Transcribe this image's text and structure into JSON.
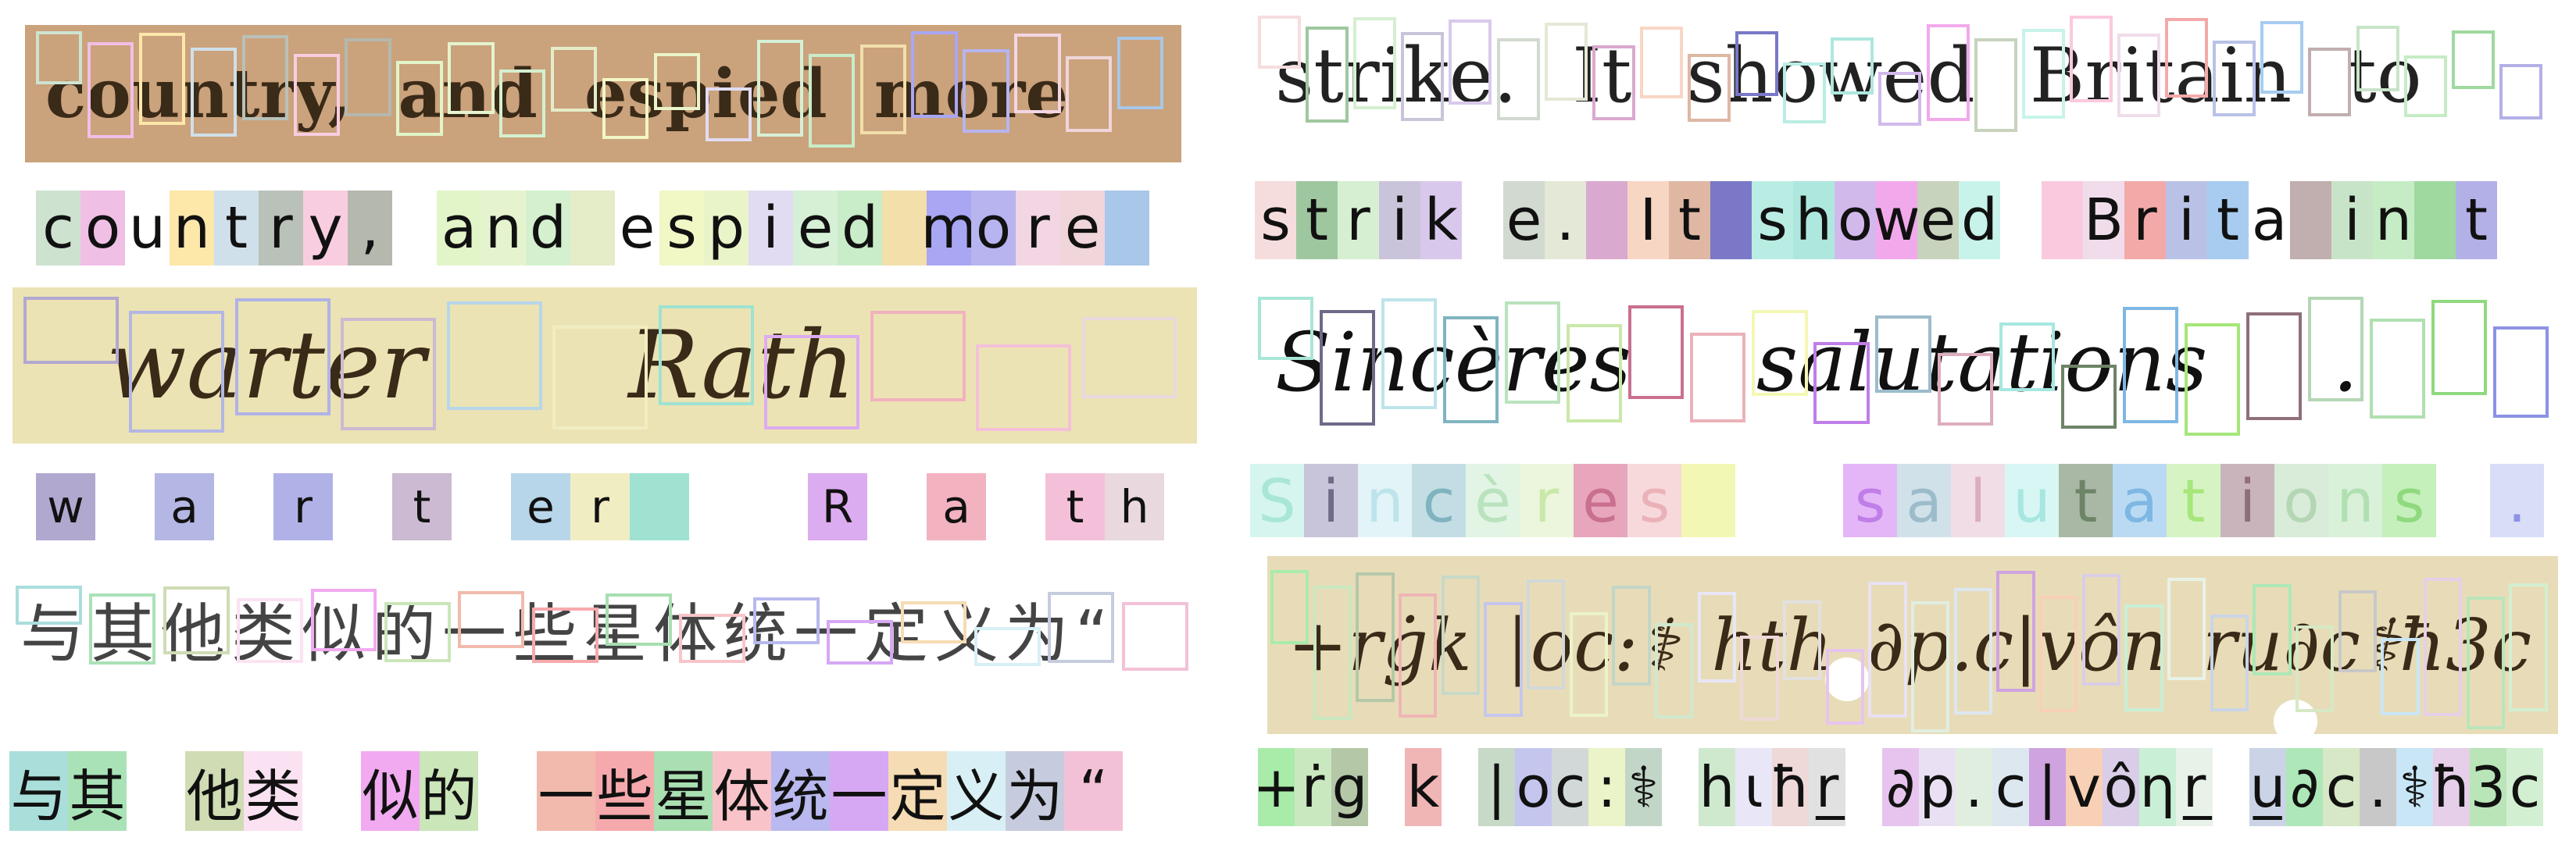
{
  "panels": [
    {
      "id": "p1",
      "image_text": [
        "country,",
        "and",
        "espied",
        "more"
      ],
      "bg": "#caa27c",
      "ink_color": "#3b2a1c",
      "ink_font": "serif",
      "cells": [
        {
          "t": "c",
          "c": "#cde3cf"
        },
        {
          "t": "o",
          "c": "#f0bfe6"
        },
        {
          "t": "u",
          "c": "#ffffff"
        },
        {
          "t": "n",
          "c": "#fde7a9"
        },
        {
          "t": "t",
          "c": "#cfe0ea"
        },
        {
          "t": "r",
          "c": "#b9c1b8"
        },
        {
          "t": "y",
          "c": "#f9cde0"
        },
        {
          "t": ",",
          "c": "#b4b8ad"
        },
        {
          "t": " ",
          "c": "#ffffff"
        },
        {
          "t": "a",
          "c": "#e2f5c8"
        },
        {
          "t": "n",
          "c": "#e5f4ce"
        },
        {
          "t": "d",
          "c": "#d4f0cf"
        },
        {
          "t": " ",
          "c": "#e4ecc8"
        },
        {
          "t": "e",
          "c": "#ffffff"
        },
        {
          "t": "s",
          "c": "#f2f7c6"
        },
        {
          "t": "p",
          "c": "#eaf4c9"
        },
        {
          "t": "i",
          "c": "#e1dcf2"
        },
        {
          "t": "e",
          "c": "#d6f0d6"
        },
        {
          "t": "d",
          "c": "#c9ecc9"
        },
        {
          "t": " ",
          "c": "#f2dfaa"
        },
        {
          "t": "m",
          "c": "#a9a6f4"
        },
        {
          "t": "o",
          "c": "#b7b4f0"
        },
        {
          "t": "r",
          "c": "#f3d6e4"
        },
        {
          "t": "e",
          "c": "#f0d5da"
        },
        {
          "t": " ",
          "c": "#a9c7e8"
        }
      ]
    },
    {
      "id": "p2",
      "image_text": [
        "strike.",
        "It",
        "showed",
        "Britain",
        "to"
      ],
      "bg": "#ffffff",
      "ink_color": "#222222",
      "ink_font": "hand",
      "cells": [
        {
          "t": "s",
          "c": "#f6dddd"
        },
        {
          "t": "t",
          "c": "#9fc79f"
        },
        {
          "t": "r",
          "c": "#d6efd2"
        },
        {
          "t": "i",
          "c": "#c9c4da"
        },
        {
          "t": "k",
          "c": "#d8c9ec"
        },
        {
          "t": " ",
          "c": "#ffffff"
        },
        {
          "t": "e",
          "c": "#d2d9d0"
        },
        {
          "t": ".",
          "c": "#e4e8d6"
        },
        {
          "t": " ",
          "c": "#d9a9cf"
        },
        {
          "t": "I",
          "c": "#f8d6c4"
        },
        {
          "t": "t",
          "c": "#dfb7a3"
        },
        {
          "t": " ",
          "c": "#7a78c7"
        },
        {
          "t": "s",
          "c": "#b9ede4"
        },
        {
          "t": "h",
          "c": "#aee7dd"
        },
        {
          "t": "o",
          "c": "#d1b9ec"
        },
        {
          "t": "w",
          "c": "#f2a9ec"
        },
        {
          "t": "e",
          "c": "#c7d3bc"
        },
        {
          "t": "d",
          "c": "#c8f3ea"
        },
        {
          "t": " ",
          "c": "#ffffff"
        },
        {
          "t": " ",
          "c": "#fbc9de"
        },
        {
          "t": "B",
          "c": "#f0dcea"
        },
        {
          "t": "r",
          "c": "#f4a9a9"
        },
        {
          "t": "i",
          "c": "#b9c2e6"
        },
        {
          "t": "t",
          "c": "#a7ccf0"
        },
        {
          "t": "a",
          "c": "#ffffff"
        },
        {
          "t": " ",
          "c": "#c1aeae"
        },
        {
          "t": "i",
          "c": "#c8e4c8"
        },
        {
          "t": "n",
          "c": "#c5ecc5"
        },
        {
          "t": " ",
          "c": "#9fd99f"
        },
        {
          "t": "t",
          "c": "#b3b0e7"
        }
      ]
    },
    {
      "id": "p3",
      "image_text": [
        "warter",
        "Rath"
      ],
      "bg": "#ebe3b4",
      "ink_color": "#3a2410",
      "ink_font": "hand",
      "cells": [
        {
          "t": "w",
          "c": "#b1a8d0"
        },
        {
          "t": " ",
          "c": "#ffffff"
        },
        {
          "t": "a",
          "c": "#b4b6e4"
        },
        {
          "t": " ",
          "c": "#ffffff"
        },
        {
          "t": "r",
          "c": "#b0b2e7"
        },
        {
          "t": " ",
          "c": "#ffffff"
        },
        {
          "t": "t",
          "c": "#cbbad2"
        },
        {
          "t": " ",
          "c": "#ffffff"
        },
        {
          "t": "e",
          "c": "#b7d6ea"
        },
        {
          "t": "r",
          "c": "#f1edc2"
        },
        {
          "t": " ",
          "c": "#9fe2d2"
        },
        {
          "t": " ",
          "c": "#ffffff"
        },
        {
          "t": " ",
          "c": "#ffffff"
        },
        {
          "t": "R",
          "c": "#dcacf0"
        },
        {
          "t": " ",
          "c": "#ffffff"
        },
        {
          "t": "a",
          "c": "#f2b2bf"
        },
        {
          "t": " ",
          "c": "#ffffff"
        },
        {
          "t": "t",
          "c": "#f4c0d9"
        },
        {
          "t": "h",
          "c": "#ead8df"
        }
      ]
    },
    {
      "id": "p4",
      "image_text": [
        "Sincères",
        "salutations",
        "."
      ],
      "bg": "#ffffff",
      "ink_color": "#111111",
      "ink_font": "hand",
      "cells": [
        {
          "t": "S",
          "c": "#d5f5ee",
          "fg": "#a9e6d8"
        },
        {
          "t": "i",
          "c": "#c8c4d9",
          "fg": "#6e6a88"
        },
        {
          "t": "n",
          "c": "#e2f4f8",
          "fg": "#bde4ea"
        },
        {
          "t": "c",
          "c": "#c3dde4",
          "fg": "#7fb4bf"
        },
        {
          "t": "è",
          "c": "#e2f4e4",
          "fg": "#b9e3bd"
        },
        {
          "t": "r",
          "c": "#ecf6dc",
          "fg": "#c9e8a9"
        },
        {
          "t": "e",
          "c": "#e7a6bc",
          "fg": "#c96f90"
        },
        {
          "t": "s",
          "c": "#f7d9dc",
          "fg": "#eab2b8"
        },
        {
          "t": " ",
          "c": "#f3f7b4"
        },
        {
          "t": " ",
          "c": "#ffffff"
        },
        {
          "t": " ",
          "c": "#ffffff"
        },
        {
          "t": "s",
          "c": "#e4b6f7",
          "fg": "#bf7ee8"
        },
        {
          "t": "a",
          "c": "#d0e1ea",
          "fg": "#9cbccb"
        },
        {
          "t": "l",
          "c": "#f1dde5",
          "fg": "#dcadbd"
        },
        {
          "t": "u",
          "c": "#d8f6f4",
          "fg": "#a6e7e0"
        },
        {
          "t": "t",
          "c": "#a8b8a4",
          "fg": "#6d8467"
        },
        {
          "t": "a",
          "c": "#b9daf2",
          "fg": "#7eb7e3"
        },
        {
          "t": "t",
          "c": "#d6f3c4",
          "fg": "#a6e67a"
        },
        {
          "t": "i",
          "c": "#c9b4bb",
          "fg": "#8f6f78"
        },
        {
          "t": "o",
          "c": "#d9ebd9",
          "fg": "#b4d6b4"
        },
        {
          "t": "n",
          "c": "#d9f0d9",
          "fg": "#b0e0b0"
        },
        {
          "t": "s",
          "c": "#c5efbb",
          "fg": "#8fd97e"
        },
        {
          "t": " ",
          "c": "#ffffff"
        },
        {
          "t": ".",
          "c": "#d9ddf7",
          "fg": "#8b93e4"
        }
      ]
    },
    {
      "id": "p5",
      "image_text": [
        "与其他类似的一些星体统一定义为“"
      ],
      "bg": "#ffffff",
      "ink_color": "#333333",
      "ink_font": "cjk",
      "cells": [
        {
          "t": "与",
          "c": "#a9dedb"
        },
        {
          "t": "其",
          "c": "#a9e2b6"
        },
        {
          "t": " ",
          "c": "#ffffff"
        },
        {
          "t": "他",
          "c": "#cfdcb4"
        },
        {
          "t": "类",
          "c": "#fbe2f2"
        },
        {
          "t": " ",
          "c": "#ffffff"
        },
        {
          "t": "似",
          "c": "#f1aaf0"
        },
        {
          "t": "的",
          "c": "#cbe6b9"
        },
        {
          "t": " ",
          "c": "#ffffff"
        },
        {
          "t": "一",
          "c": "#f2b9ad"
        },
        {
          "t": "些",
          "c": "#f6a9ac"
        },
        {
          "t": "星",
          "c": "#a9dfb1"
        },
        {
          "t": "体",
          "c": "#f8c4c9"
        },
        {
          "t": "统",
          "c": "#b9b9ef"
        },
        {
          "t": "一",
          "c": "#d6a8f4"
        },
        {
          "t": "定",
          "c": "#f6dcb4"
        },
        {
          "t": "义",
          "c": "#d8f0f5"
        },
        {
          "t": "为",
          "c": "#c6ccde"
        },
        {
          "t": "“",
          "c": "#f3c1d7"
        }
      ]
    },
    {
      "id": "p6",
      "image_text": [
        "+rġk",
        "|oc:⚕",
        "hth",
        "∂p.c|vôn",
        "ru∂c⚕ħ3c"
      ],
      "bg": "#e8dcb8",
      "ink_color": "#3c2a1a",
      "ink_font": "hand",
      "cells": [
        {
          "t": "+",
          "c": "#a9eba9"
        },
        {
          "t": "ṙ",
          "c": "#c9e8bf"
        },
        {
          "t": "g",
          "c": "#b4c8a8"
        },
        {
          "t": " ",
          "c": "#ffffff"
        },
        {
          "t": "k",
          "c": "#f0b5b5"
        },
        {
          "t": " ",
          "c": "#ffffff"
        },
        {
          "t": "|",
          "c": "#c7d9c7"
        },
        {
          "t": "o",
          "c": "#c5c6ed"
        },
        {
          "t": "c",
          "c": "#d2d8d8"
        },
        {
          "t": ":",
          "c": "#ebf3c8"
        },
        {
          "t": "⚕",
          "c": "#c1d6c7"
        },
        {
          "t": " ",
          "c": "#ffffff"
        },
        {
          "t": "h",
          "c": "#cfe9cf"
        },
        {
          "t": "ι",
          "c": "#e8e6f7"
        },
        {
          "t": "ħ",
          "c": "#eed8d8"
        },
        {
          "t": "r̲",
          "c": "#e1e1e1"
        },
        {
          "t": " ",
          "c": "#ffffff"
        },
        {
          "t": "∂",
          "c": "#e6c4ee"
        },
        {
          "t": "p",
          "c": "#e9e1f3"
        },
        {
          "t": ".",
          "c": "#e0eee0"
        },
        {
          "t": "c",
          "c": "#dde7f0"
        },
        {
          "t": "|",
          "c": "#cfa3e0"
        },
        {
          "t": "v",
          "c": "#f8d0b6"
        },
        {
          "t": "ô",
          "c": "#d9cde8"
        },
        {
          "t": "η",
          "c": "#c9efd6"
        },
        {
          "t": "r̲",
          "c": "#e8f2e8"
        },
        {
          "t": " ",
          "c": "#ffffff"
        },
        {
          "t": "u̲",
          "c": "#cad4e6"
        },
        {
          "t": "∂",
          "c": "#aee7b8"
        },
        {
          "t": "c",
          "c": "#d7e8c6"
        },
        {
          "t": ".",
          "c": "#c8c8c8"
        },
        {
          "t": "⚕",
          "c": "#c8e6f6"
        },
        {
          "t": "ħ",
          "c": "#e5cfe9"
        },
        {
          "t": "3",
          "c": "#b9e5b9"
        },
        {
          "t": "c",
          "c": "#d2efd2"
        }
      ]
    }
  ],
  "icons": {
    "p6_marker_1": "white-dot-icon",
    "p6_marker_2": "white-dot-icon"
  }
}
